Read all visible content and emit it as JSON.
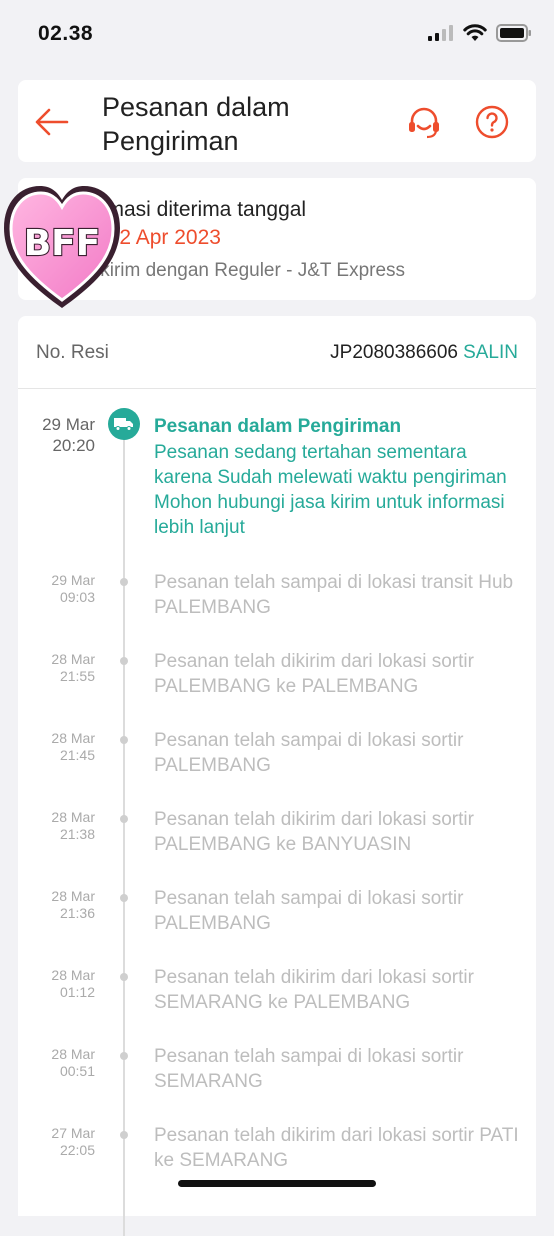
{
  "status_bar": {
    "time": "02.38"
  },
  "header": {
    "title": "Pesanan dalam Pengiriman"
  },
  "estimate": {
    "label": "timasi diterima tanggal",
    "date": "n, 2 Apr 2023",
    "courier": "ikirim dengan Reguler - J&T Express"
  },
  "sticker": {
    "text": "BFF"
  },
  "resi": {
    "label": "No. Resi",
    "number": "JP2080386606",
    "copy_label": "SALIN"
  },
  "events": [
    {
      "date": "29 Mar",
      "time": "20:20",
      "title": "Pesanan dalam Pengiriman",
      "text": "Pesanan sedang tertahan sementara karena Sudah melewati waktu pengiriman Mohon hubungi jasa kirim untuk informasi lebih lanjut"
    },
    {
      "date": "29 Mar",
      "time": "09:03",
      "text": "Pesanan telah sampai di lokasi transit Hub PALEMBANG"
    },
    {
      "date": "28 Mar",
      "time": "21:55",
      "text": "Pesanan telah dikirim dari lokasi sortir PALEMBANG ke PALEMBANG"
    },
    {
      "date": "28 Mar",
      "time": "21:45",
      "text": "Pesanan telah sampai di lokasi sortir PALEMBANG"
    },
    {
      "date": "28 Mar",
      "time": "21:38",
      "text": "Pesanan telah dikirim dari lokasi sortir PALEMBANG ke BANYUASIN"
    },
    {
      "date": "28 Mar",
      "time": "21:36",
      "text": "Pesanan telah sampai di lokasi sortir PALEMBANG"
    },
    {
      "date": "28 Mar",
      "time": "01:12",
      "text": "Pesanan telah dikirim dari lokasi sortir SEMARANG ke PALEMBANG"
    },
    {
      "date": "28 Mar",
      "time": "00:51",
      "text": "Pesanan telah sampai di lokasi sortir SEMARANG"
    },
    {
      "date": "27 Mar",
      "time": "22:05",
      "text": "Pesanan telah dikirim dari lokasi sortir PATI ke SEMARANG"
    }
  ],
  "colors": {
    "accent": "#ee4d2d",
    "teal": "#26aa99",
    "muted": "#bdbdbd"
  }
}
